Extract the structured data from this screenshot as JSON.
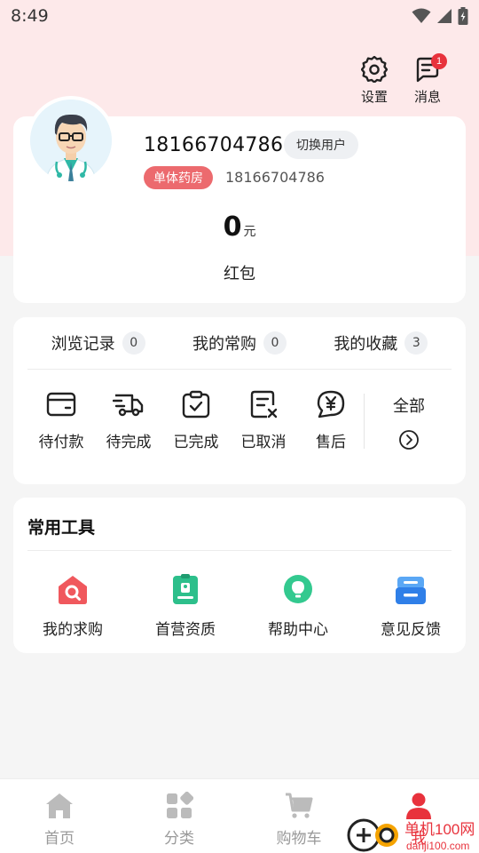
{
  "status_bar": {
    "time": "8:49"
  },
  "header": {
    "settings_label": "设置",
    "messages_label": "消息",
    "messages_badge": "1"
  },
  "profile": {
    "phone": "18166704786",
    "switch_user_label": "切换用户",
    "type_tag": "单体药房",
    "account": "18166704786",
    "redpacket_amount": "0",
    "redpacket_unit": "元",
    "redpacket_label": "红包"
  },
  "stats": [
    {
      "label": "浏览记录",
      "count": "0"
    },
    {
      "label": "我的常购",
      "count": "0"
    },
    {
      "label": "我的收藏",
      "count": "3"
    }
  ],
  "orders": [
    {
      "label": "待付款",
      "icon": "wallet-icon"
    },
    {
      "label": "待完成",
      "icon": "delivery-truck-icon"
    },
    {
      "label": "已完成",
      "icon": "clipboard-check-icon"
    },
    {
      "label": "已取消",
      "icon": "document-cancel-icon"
    },
    {
      "label": "售后",
      "icon": "yuan-chat-icon"
    }
  ],
  "all_orders_label": "全部",
  "tools": {
    "title": "常用工具",
    "items": [
      {
        "label": "我的求购",
        "icon": "search-house-icon",
        "color": "#f0585d"
      },
      {
        "label": "首营资质",
        "icon": "id-badge-icon",
        "color": "#2dbf8b"
      },
      {
        "label": "帮助中心",
        "icon": "lightbulb-icon",
        "color": "#33c98f"
      },
      {
        "label": "意见反馈",
        "icon": "inbox-tray-icon",
        "color": "#3d8ef0"
      }
    ]
  },
  "tabbar": [
    {
      "label": "首页",
      "icon": "home-icon"
    },
    {
      "label": "分类",
      "icon": "grid-icon"
    },
    {
      "label": "购物车",
      "icon": "cart-icon"
    },
    {
      "label": "我",
      "icon": "user-icon",
      "active": true
    }
  ],
  "watermark": {
    "site": "单机100网",
    "url": "danji100.com"
  },
  "colors": {
    "accent": "#e8323c",
    "header_bg": "#fde9ea",
    "tag_bg": "#ec6a6e"
  }
}
